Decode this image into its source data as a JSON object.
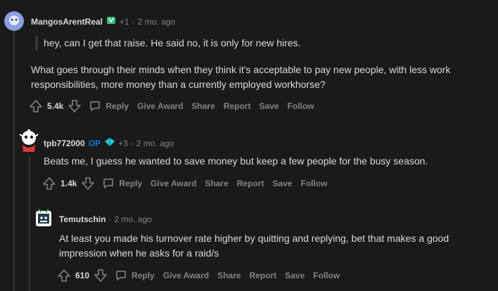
{
  "comments": [
    {
      "username": "MangosArentReal",
      "plus": "+1",
      "sep": "·",
      "time": "2 mo. ago",
      "quote": "hey, can I get that raise. He said no, it is only for new hires.",
      "text": "What goes through their minds when they think it's acceptable to pay new people, with less work responsibilities, more money than a currently employed workhorse?",
      "score": "5.4k",
      "actions": {
        "reply": "Reply",
        "award": "Give Award",
        "share": "Share",
        "report": "Report",
        "save": "Save",
        "follow": "Follow"
      }
    },
    {
      "username": "tpb772000",
      "op": "OP",
      "plus": "+3",
      "sep": "·",
      "time": "2 mo. ago",
      "text": "Beats me, I guess he wanted to save money but keep a few people for the busy season.",
      "score": "1.4k",
      "actions": {
        "reply": "Reply",
        "award": "Give Award",
        "share": "Share",
        "report": "Report",
        "save": "Save",
        "follow": "Follow"
      }
    },
    {
      "username": "Temutschin",
      "sep": "·",
      "time": "2 mo. ago",
      "text_line1": "At least you made his turnover rate higher by quitting and replying, bet that makes a good",
      "text_line2": "impression when he asks for a raid/s",
      "score": "610",
      "actions": {
        "reply": "Reply",
        "award": "Give Award",
        "share": "Share",
        "report": "Report",
        "save": "Save",
        "follow": "Follow"
      }
    }
  ],
  "colors": {
    "background": "#1a1a1b",
    "text": "#d7dadc",
    "muted": "#818384",
    "op": "#0079d3",
    "thread_line": "#343536"
  },
  "icons": [
    "avatar",
    "award-icon",
    "upvote-icon",
    "downvote-icon",
    "reply-icon"
  ]
}
